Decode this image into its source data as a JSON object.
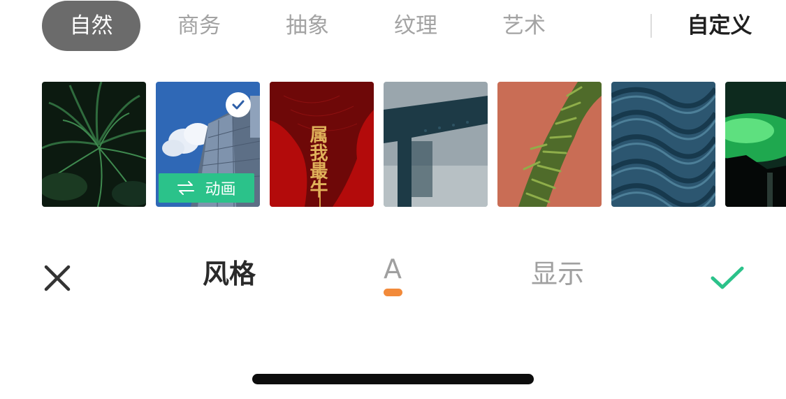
{
  "categories": {
    "items": [
      {
        "label": "自然",
        "active": true
      },
      {
        "label": "商务",
        "active": false
      },
      {
        "label": "抽象",
        "active": false
      },
      {
        "label": "纹理",
        "active": false
      },
      {
        "label": "艺术",
        "active": false
      }
    ],
    "custom_label": "自定义"
  },
  "thumbnails": {
    "selected_index": 1,
    "animation_badge_label": "动画",
    "poster_calligraphy": "属我最牛"
  },
  "toolbar": {
    "style_label": "风格",
    "font_label": "A",
    "display_label": "显示"
  },
  "colors": {
    "accent_green": "#2bc28a",
    "active_tab_bg": "#6b6b6b",
    "font_indicator": "#f28a3a",
    "confirm_check": "#2bc28a"
  },
  "icons": {
    "close": "close-icon",
    "confirm": "checkmark-icon",
    "selected": "check-circle-icon",
    "animation": "swap-arrows-icon"
  }
}
